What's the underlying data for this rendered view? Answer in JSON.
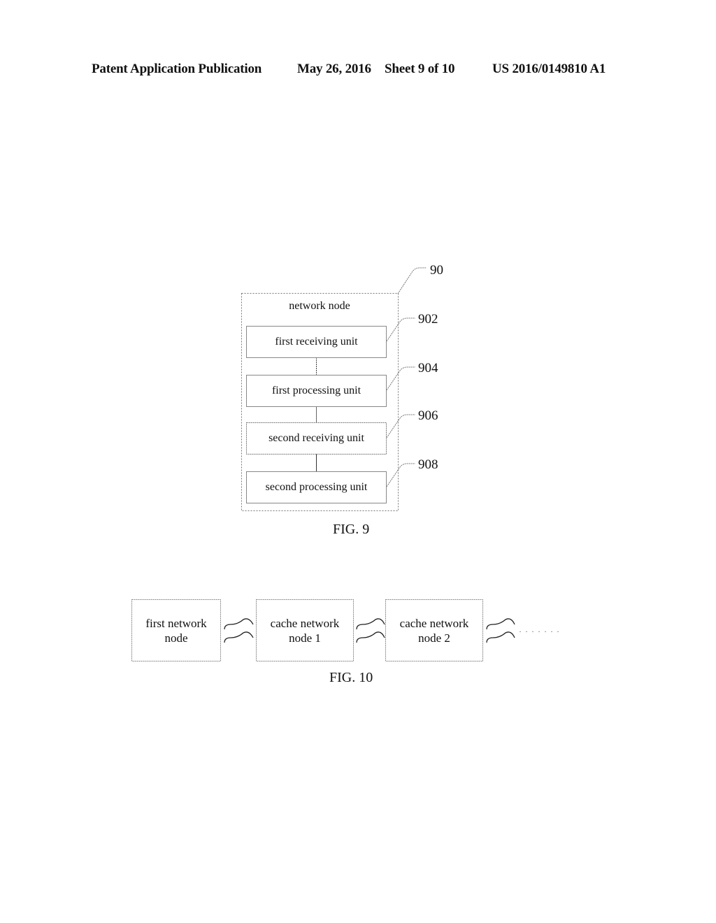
{
  "header": {
    "publication": "Patent Application Publication",
    "date": "May 26, 2016",
    "sheet": "Sheet 9 of 10",
    "number": "US 2016/0149810 A1"
  },
  "fig9": {
    "caption": "FIG. 9",
    "container": {
      "label": "network node",
      "ref": "90"
    },
    "units": [
      {
        "label": "first receiving unit",
        "ref": "902"
      },
      {
        "label": "first processing unit",
        "ref": "904"
      },
      {
        "label": "second receiving unit",
        "ref": "906"
      },
      {
        "label": "second processing unit",
        "ref": "908"
      }
    ]
  },
  "fig10": {
    "caption": "FIG. 10",
    "nodes": [
      {
        "label": "first network\nnode"
      },
      {
        "label": "cache network\nnode 1"
      },
      {
        "label": "cache network\nnode 2"
      }
    ],
    "continuation": "· · · · · · ·"
  }
}
